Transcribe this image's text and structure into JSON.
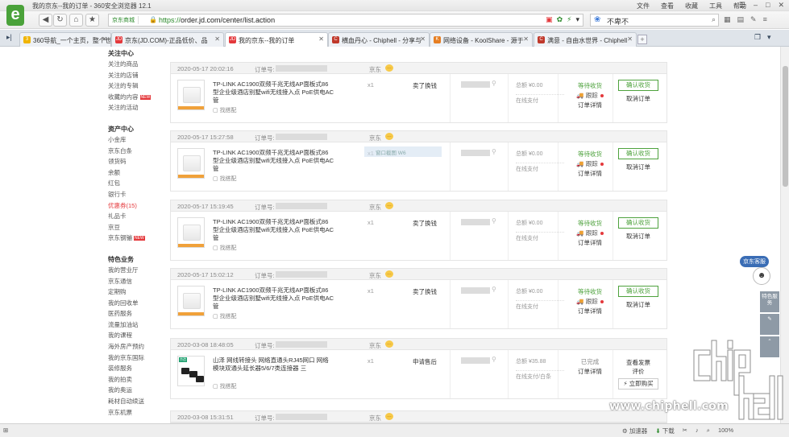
{
  "window": {
    "title": "我的京东--我的订单 - 360安全浏览器 12.1"
  },
  "menu": [
    "文件",
    "查看",
    "收藏",
    "工具",
    "帮助"
  ],
  "address": {
    "site_label": "京东商城",
    "scheme": "https://",
    "url": "order.jd.com/center/list.action"
  },
  "search": {
    "value": "不卑不"
  },
  "tabs": [
    {
      "label": "360导航_一个主页，整个世界",
      "icon": "360-icon",
      "color": "#f0b400"
    },
    {
      "label": "京东(JD.COM)-正品低价、品",
      "icon": "jd-icon",
      "color": "#e4393c"
    },
    {
      "label": "我的京东--我的订单",
      "icon": "jd-icon",
      "color": "#e4393c",
      "active": true
    },
    {
      "label": "横血丹心 - Chiphell - 分享与",
      "icon": "chiphell-icon",
      "color": "#c0392b"
    },
    {
      "label": "网络设备 - KoolShare - 源于",
      "icon": "koolshare-icon",
      "color": "#e67e22"
    },
    {
      "label": "满意 - 自由水世界 - Chiphell",
      "icon": "chiphell-icon",
      "color": "#c0392b"
    }
  ],
  "sidebar": {
    "groups": [
      {
        "title": "关注中心",
        "items": [
          "关注的商品",
          "关注的店铺",
          "关注的专辑",
          "收藏的内容",
          "关注的活动"
        ],
        "new_index": 3
      },
      {
        "title": "资产中心",
        "items": [
          "小金库",
          "京东白条",
          "领货码",
          "余额",
          "红包",
          "银行卡",
          "优惠券(15)",
          "礼品卡",
          "京豆",
          "京东钢镚"
        ],
        "new_index": 9,
        "red_index": 6
      },
      {
        "title": "特色业务",
        "items": [
          "我的营业厅",
          "京东通信",
          "定期购",
          "我的回收单",
          "医药服务",
          "流量加油站",
          "我的课程",
          "海外房产预约",
          "我的京东国际",
          "装修服务",
          "我的拍卖",
          "我的奥运",
          "耗材自动续送",
          "京东机票"
        ]
      }
    ],
    "new_label": "NEW"
  },
  "orders": [
    {
      "date": "2020-05-17 20:02:16",
      "num_label": "订单号:",
      "shop": "京东",
      "product": "TP-LINK AC1900双频千兆无线AP面板式86型企业级酒店别墅wifi无线接入点 PoE供电AC管",
      "find": "找搭配",
      "qty": "x1",
      "action": "卖了换钱",
      "total": "总额 ¥0.00",
      "pay": "在线支付",
      "status": "等待收货",
      "track": "跟踪",
      "detail": "订单详情",
      "btn1": "确认收货",
      "btn2": "取消订单"
    },
    {
      "date": "2020-05-17 15:27:58",
      "num_label": "订单号:",
      "shop": "京东",
      "product": "TP-LINK AC1900双频千兆无线AP面板式86型企业级酒店别墅wifi无线接入点 PoE供电AC管",
      "find": "找搭配",
      "qty": "x1",
      "action": "",
      "total": "总额 ¥0.00",
      "pay": "在线支付",
      "status": "等待收货",
      "track": "跟踪",
      "detail": "订单详情",
      "btn1": "确认收货",
      "btn2": "取消订单"
    },
    {
      "date": "2020-05-17 15:19:45",
      "num_label": "订单号:",
      "shop": "京东",
      "product": "TP-LINK AC1900双频千兆无线AP面板式86型企业级酒店别墅wifi无线接入点 PoE供电AC管",
      "find": "找搭配",
      "qty": "x1",
      "action": "卖了换钱",
      "total": "总额 ¥0.00",
      "pay": "在线支付",
      "status": "等待收货",
      "track": "跟踪",
      "detail": "订单详情",
      "btn1": "确认收货",
      "btn2": "取消订单"
    },
    {
      "date": "2020-05-17 15:02:12",
      "num_label": "订单号:",
      "shop": "京东",
      "product": "TP-LINK AC1900双频千兆无线AP面板式86型企业级酒店别墅wifi无线接入点 PoE供电AC管",
      "find": "找搭配",
      "qty": "x1",
      "action": "卖了换钱",
      "total": "总额 ¥0.00",
      "pay": "在线支付",
      "status": "等待收货",
      "track": "跟踪",
      "detail": "订单详情",
      "btn1": "确认收货",
      "btn2": "取消订单"
    },
    {
      "date": "2020-03-08 18:48:05",
      "num_label": "订单号:",
      "shop": "京东",
      "product": "山泽 网线转接头 网络直通头RJ45网口 网络模块双通头延长器5/6/7类连接器 三",
      "find": "找搭配",
      "qty": "x1",
      "action": "申请售后",
      "total": "总额 ¥35.88",
      "pay": "在线支付/白条",
      "status": "已完成",
      "track": "",
      "detail": "订单详情",
      "btn1": "查看发票",
      "btn1b": "评价",
      "btn2": "立即购买"
    },
    {
      "date": "2020-03-08 15:31:51",
      "num_label": "订单号:",
      "shop": "京东"
    }
  ],
  "ghost_tooltip": "窗口截图 W6",
  "helper": {
    "bubble": "京东客服",
    "rail1": "特色服务",
    "rail2": "✎",
    "rail3": "⌃"
  },
  "watermark": "www.chiphell.com",
  "statusbar": {
    "items": [
      "加速器",
      "下载",
      "100%"
    ]
  }
}
